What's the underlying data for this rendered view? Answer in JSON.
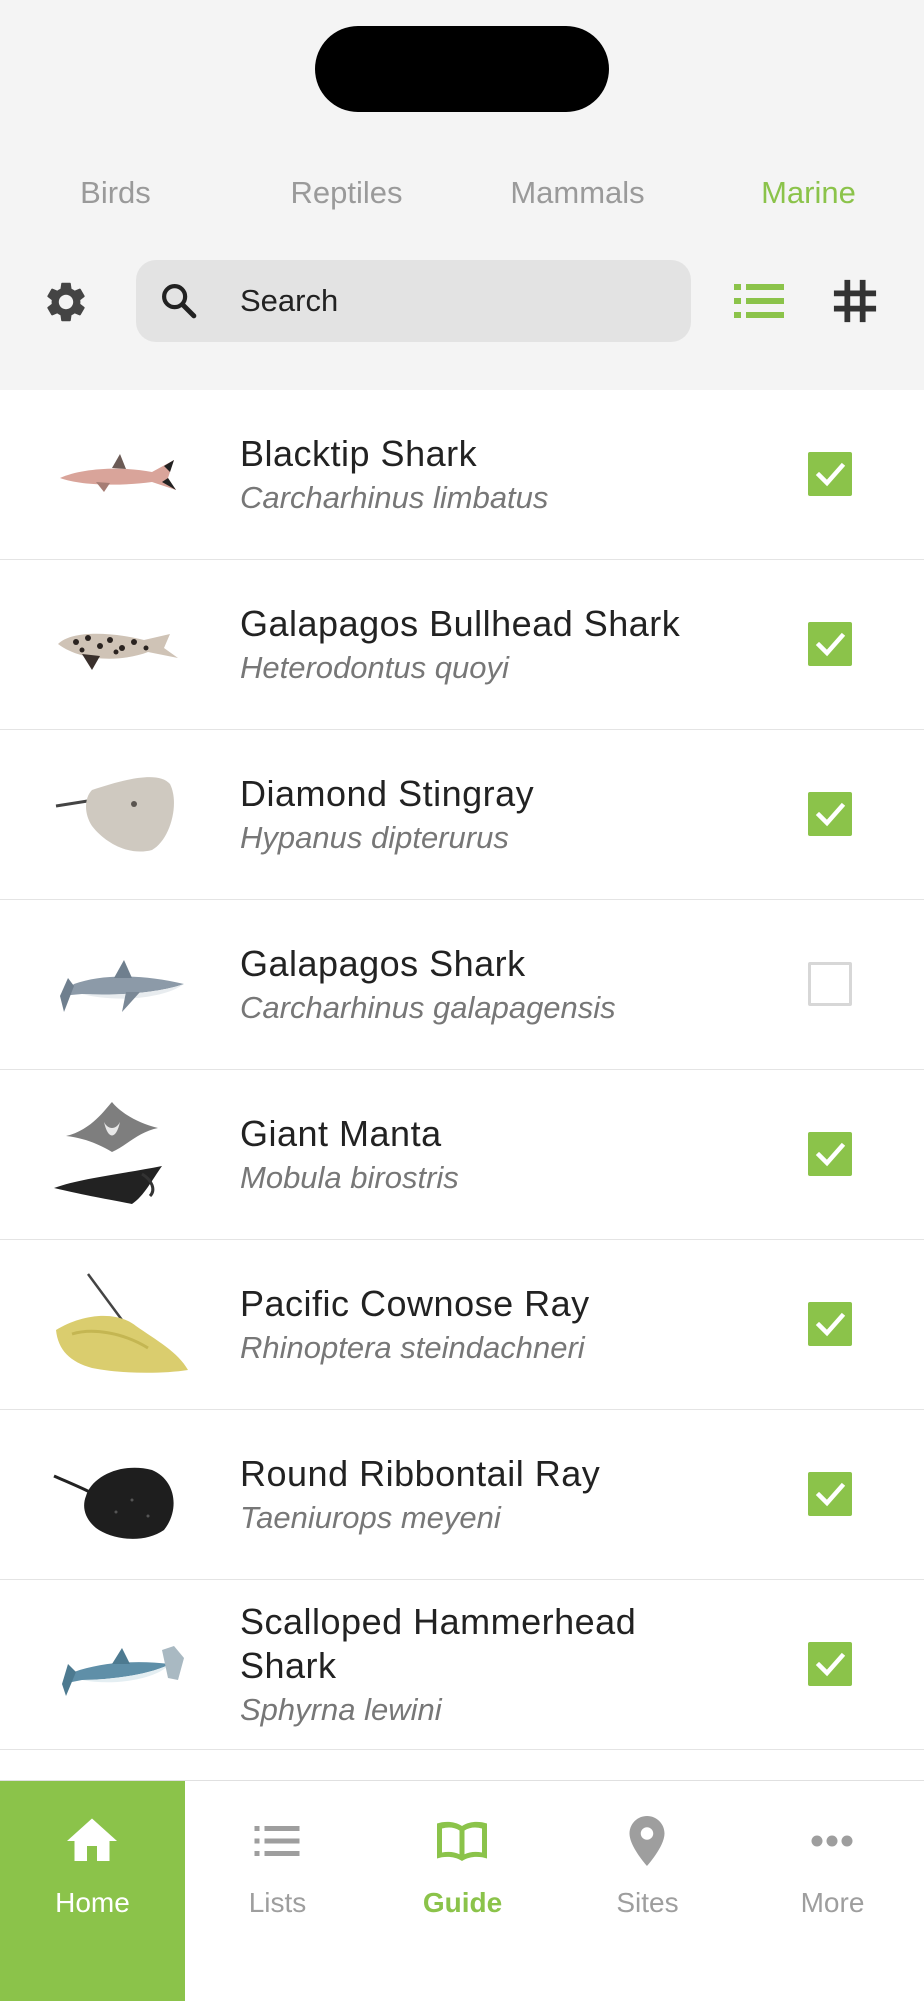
{
  "categories": [
    {
      "label": "Birds",
      "active": false
    },
    {
      "label": "Reptiles",
      "active": false
    },
    {
      "label": "Mammals",
      "active": false
    },
    {
      "label": "Marine",
      "active": true
    }
  ],
  "search": {
    "placeholder": "Search",
    "value": ""
  },
  "colors": {
    "accent": "#8bc34a",
    "inactive": "#9a9a9a",
    "text": "#222222",
    "scientific": "#777777"
  },
  "icons": {
    "settings": "gear-icon",
    "search": "search-icon",
    "list_view": "list-view-icon",
    "grid_view": "grid-view-icon"
  },
  "species": [
    {
      "common": "Blacktip Shark",
      "scientific": "Carcharhinus limbatus",
      "seen": true,
      "icon": "shark-image"
    },
    {
      "common": "Galapagos Bullhead Shark",
      "scientific": "Heterodontus quoyi",
      "seen": true,
      "icon": "bullhead-shark-image"
    },
    {
      "common": "Diamond Stingray",
      "scientific": "Hypanus dipterurus",
      "seen": true,
      "icon": "stingray-image"
    },
    {
      "common": "Galapagos Shark",
      "scientific": "Carcharhinus galapagensis",
      "seen": false,
      "icon": "shark-image"
    },
    {
      "common": "Giant Manta",
      "scientific": "Mobula birostris",
      "seen": true,
      "icon": "manta-image"
    },
    {
      "common": "Pacific Cownose Ray",
      "scientific": "Rhinoptera steindachneri",
      "seen": true,
      "icon": "cownose-ray-image"
    },
    {
      "common": "Round Ribbontail Ray",
      "scientific": "Taeniurops meyeni",
      "seen": true,
      "icon": "ribbontail-ray-image"
    },
    {
      "common": "Scalloped Hammerhead Shark",
      "scientific": "Sphyrna lewini",
      "seen": true,
      "icon": "hammerhead-image"
    }
  ],
  "nav": [
    {
      "label": "Home",
      "icon": "home-icon",
      "state": "selected"
    },
    {
      "label": "Lists",
      "icon": "list-icon",
      "state": "normal"
    },
    {
      "label": "Guide",
      "icon": "book-icon",
      "state": "current"
    },
    {
      "label": "Sites",
      "icon": "location-pin-icon",
      "state": "normal"
    },
    {
      "label": "More",
      "icon": "more-icon",
      "state": "normal"
    }
  ]
}
